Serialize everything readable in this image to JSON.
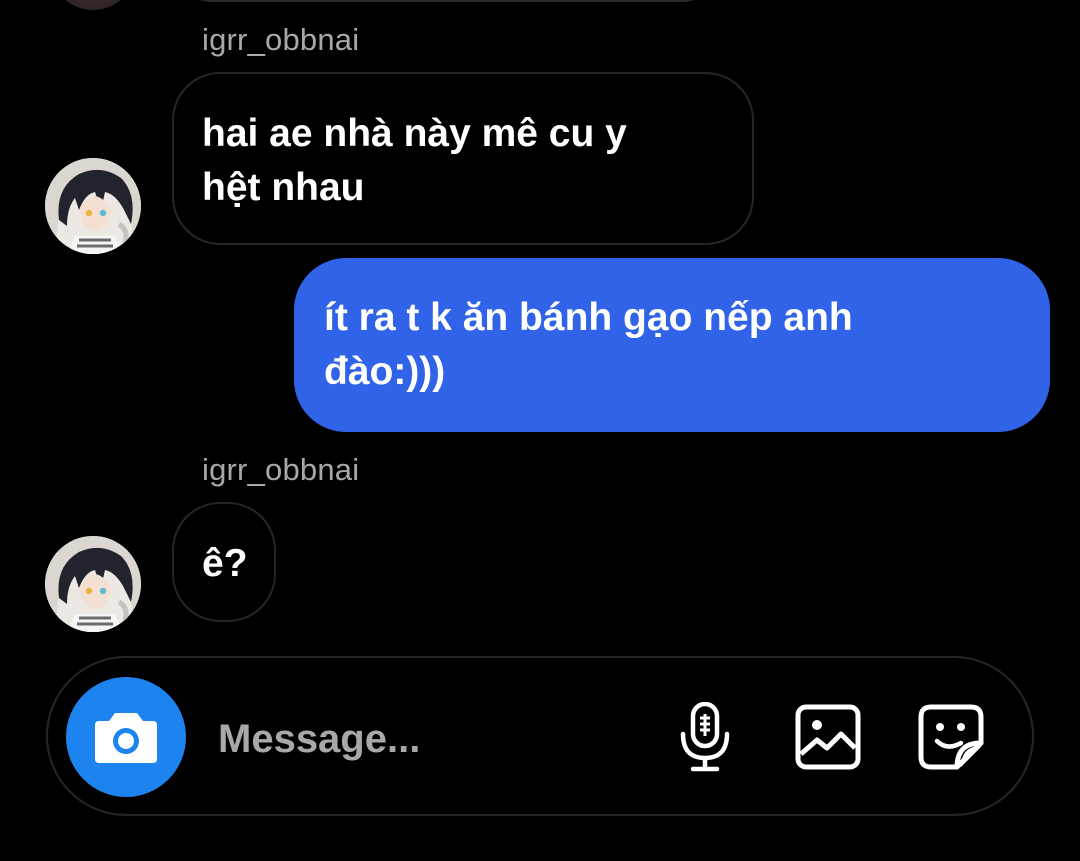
{
  "conversation": {
    "messages": [
      {
        "sender": "igrr_obbnai",
        "direction": "incoming",
        "text_lines": [
          "hai ae nhà này mê cu y",
          "hệt nhau"
        ]
      },
      {
        "direction": "outgoing",
        "text_lines": [
          "ít ra t k ăn bánh gạo nếp anh",
          "đào:)))"
        ]
      },
      {
        "sender": "igrr_obbnai",
        "direction": "incoming",
        "text_lines": [
          "ê?"
        ]
      }
    ]
  },
  "composer": {
    "placeholder": "Message...",
    "icons": [
      "camera-icon",
      "microphone-icon",
      "gallery-icon",
      "sticker-icon"
    ]
  },
  "colors": {
    "background": "#000000",
    "outgoing_bubble": "#3063e8",
    "camera_button": "#1d83ef",
    "incoming_border": "#262626",
    "secondary_text": "#a8a8a8"
  }
}
